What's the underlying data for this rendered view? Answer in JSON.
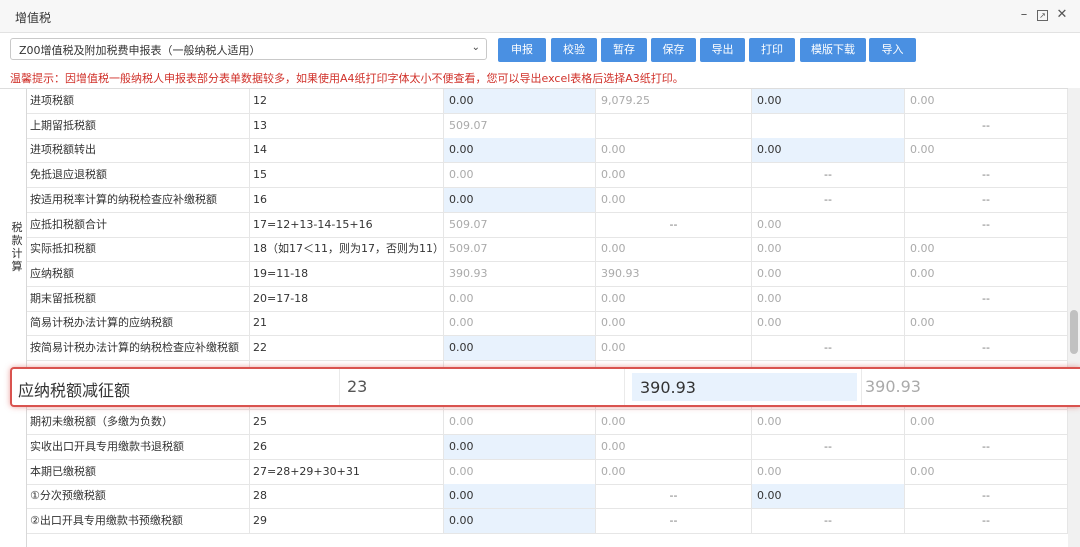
{
  "window": {
    "title": "增值税"
  },
  "toolbar": {
    "form_select": "Z00增值税及附加税费申报表（一般纳税人适用）",
    "buttons": [
      "申报",
      "校验",
      "暂存",
      "保存",
      "导出",
      "打印",
      "模版下载",
      "导入"
    ]
  },
  "tip": "温馨提示：因增值税一般纳税人申报表部分表单数据较多，如果使用A4纸打印字体太小不便查看，您可以导出excel表格后选择A3纸打印。",
  "section_label": "税款计算",
  "rows": [
    {
      "name": "进项税额",
      "no": "12",
      "v1": "0.00",
      "v2": "9,079.25",
      "v3": "0.00",
      "v4": "0.00"
    },
    {
      "name": "上期留抵税额",
      "no": "13",
      "v1": "509.07",
      "v2": "",
      "v3": "",
      "v4": "--"
    },
    {
      "name": "进项税额转出",
      "no": "14",
      "v1": "0.00",
      "v2": "0.00",
      "v3": "0.00",
      "v4": "0.00"
    },
    {
      "name": "免抵退应退税额",
      "no": "15",
      "v1": "0.00",
      "v2": "0.00",
      "v3": "--",
      "v4": "--"
    },
    {
      "name": "按适用税率计算的纳税检查应补缴税额",
      "no": "16",
      "v1": "0.00",
      "v2": "0.00",
      "v3": "--",
      "v4": "--"
    },
    {
      "name": "应抵扣税额合计",
      "no": "17=12+13-14-15+16",
      "v1": "509.07",
      "v2": "--",
      "v3": "0.00",
      "v4": "--"
    },
    {
      "name": "实际抵扣税额",
      "no": "18（如17＜11，则为17，否则为11）",
      "v1": "509.07",
      "v2": "0.00",
      "v3": "0.00",
      "v4": "0.00"
    },
    {
      "name": "应纳税额",
      "no": "19=11-18",
      "v1": "390.93",
      "v2": "390.93",
      "v3": "0.00",
      "v4": "0.00"
    },
    {
      "name": "期末留抵税额",
      "no": "20=17-18",
      "v1": "0.00",
      "v2": "0.00",
      "v3": "0.00",
      "v4": "--"
    },
    {
      "name": "简易计税办法计算的应纳税额",
      "no": "21",
      "v1": "0.00",
      "v2": "0.00",
      "v3": "0.00",
      "v4": "0.00"
    },
    {
      "name": "按简易计税办法计算的纳税检查应补缴税额",
      "no": "22",
      "v1": "0.00",
      "v2": "0.00",
      "v3": "--",
      "v4": "--"
    },
    {
      "name": "",
      "no": "",
      "v1": "",
      "v2": "",
      "v3": "",
      "v4": ""
    },
    {
      "name": "",
      "no": "",
      "v1": "",
      "v2": "",
      "v3": "",
      "v4": ""
    },
    {
      "name": "期初未缴税额（多缴为负数）",
      "no": "25",
      "v1": "0.00",
      "v2": "0.00",
      "v3": "0.00",
      "v4": "0.00"
    },
    {
      "name": "实收出口开具专用缴款书退税额",
      "no": "26",
      "v1": "0.00",
      "v2": "0.00",
      "v3": "--",
      "v4": "--"
    },
    {
      "name": "本期已缴税额",
      "no": "27=28+29+30+31",
      "v1": "0.00",
      "v2": "0.00",
      "v3": "0.00",
      "v4": "0.00"
    },
    {
      "name": "①分次预缴税额",
      "no": "28",
      "v1": "0.00",
      "v2": "--",
      "v3": "0.00",
      "v4": "--"
    },
    {
      "name": "②出口开具专用缴款书预缴税额",
      "no": "29",
      "v1": "0.00",
      "v2": "--",
      "v3": "--",
      "v4": "--"
    }
  ],
  "highlight": {
    "name": "应纳税额减征额",
    "no": "23",
    "v1": "390.93",
    "v2": "390.93"
  }
}
